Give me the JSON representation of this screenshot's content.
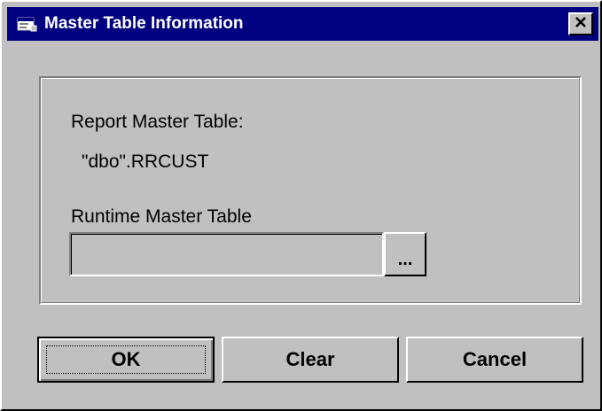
{
  "window": {
    "title": "Master Table Information",
    "title_icon": "app-window-icon",
    "close_icon": "close-icon",
    "colors": {
      "titlebar": "#000080",
      "face": "#c0c0c0"
    }
  },
  "report": {
    "label": "Report Master Table:",
    "value": "\"dbo\".RRCUST"
  },
  "runtime": {
    "label": "Runtime Master Table",
    "value": "",
    "browse_label": "..."
  },
  "buttons": {
    "ok": "OK",
    "clear": "Clear",
    "cancel": "Cancel"
  }
}
